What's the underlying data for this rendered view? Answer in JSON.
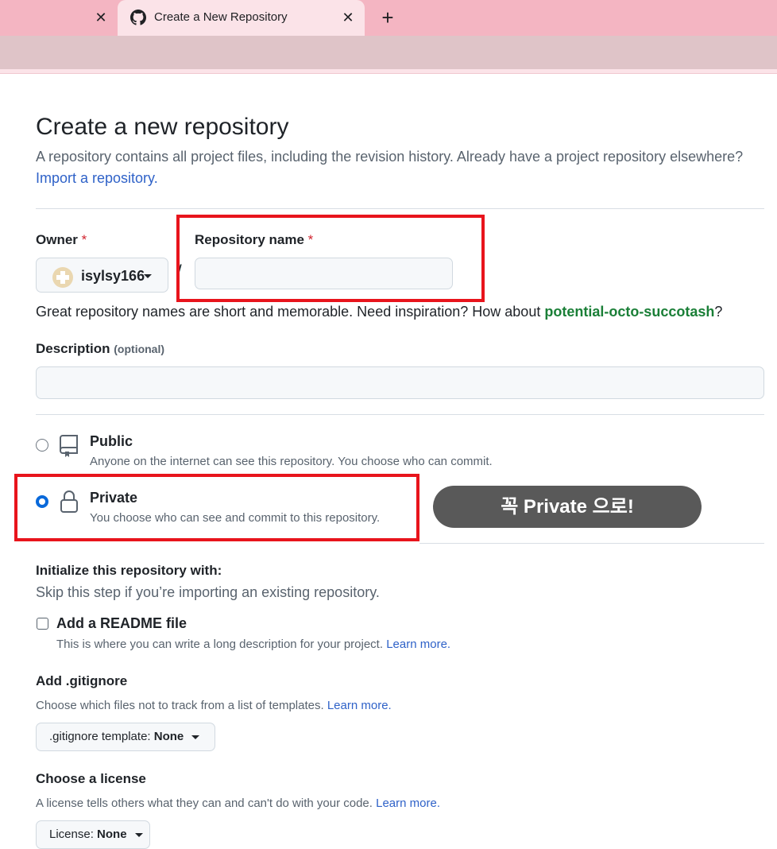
{
  "browser": {
    "tab_title": "Create a New Repository",
    "close_glyph": "✕",
    "new_tab_glyph": "+",
    "favicon": "github-icon"
  },
  "page": {
    "title": "Create a new repository",
    "subtitle": "A repository contains all project files, including the revision history. Already have a project repository elsewhere?",
    "import_link": "Import a repository."
  },
  "owner": {
    "label": "Owner",
    "required_mark": "*",
    "value": "isylsy166",
    "slash": "/"
  },
  "repo_name": {
    "label": "Repository name",
    "required_mark": "*",
    "value": ""
  },
  "hint": {
    "text": "Great repository names are short and memorable. Need inspiration? How about ",
    "suggestion": "potential-octo-succotash",
    "end": "?"
  },
  "description": {
    "label": "Description",
    "optional": "(optional)",
    "value": ""
  },
  "visibility": {
    "selected": "private",
    "public": {
      "title": "Public",
      "desc": "Anyone on the internet can see this repository. You choose who can commit."
    },
    "private": {
      "title": "Private",
      "desc": "You choose who can see and commit to this repository."
    }
  },
  "callout": "꼭 Private 으로!",
  "init": {
    "title": "Initialize this repository with:",
    "subtitle": "Skip this step if you’re importing an existing repository.",
    "readme_label": "Add a README file",
    "readme_checked": false,
    "readme_desc": "This is where you can write a long description for your project. ",
    "learn_more": "Learn more."
  },
  "gitignore": {
    "title": "Add .gitignore",
    "desc": "Choose which files not to track from a list of templates. ",
    "learn_more": "Learn more.",
    "select_prefix": ".gitignore template: ",
    "select_value": "None"
  },
  "license": {
    "title": "Choose a license",
    "desc": "A license tells others what they can and can't do with your code. ",
    "learn_more": "Learn more.",
    "select_prefix": "License: ",
    "select_value": "None"
  },
  "colors": {
    "tabstrip": "#f4b5c2",
    "link": "#2f62c8",
    "suggestion": "#1a7f37",
    "highlight": "#e8141c",
    "callout_bg": "#595959",
    "radio_checked": "#0969da"
  }
}
